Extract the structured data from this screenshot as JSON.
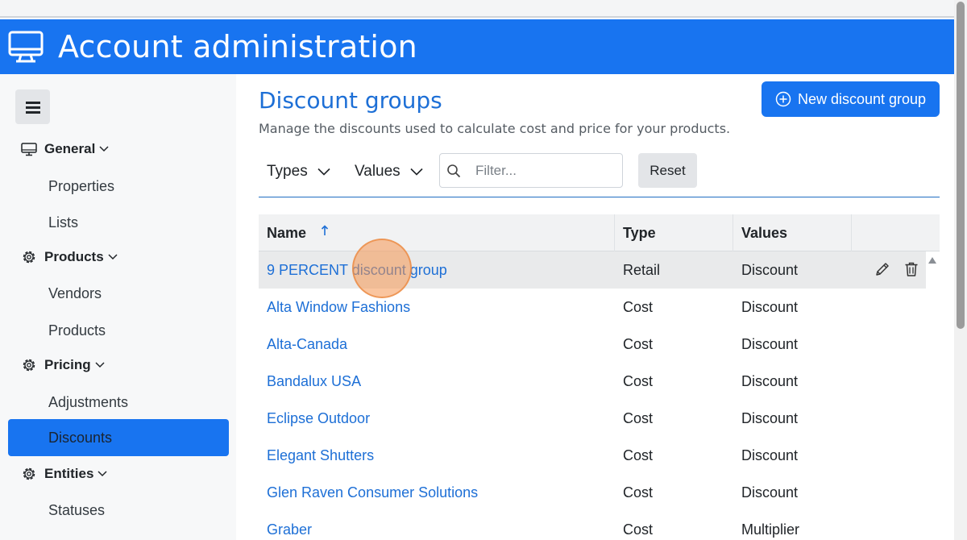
{
  "app": {
    "title": "Account administration",
    "header_color": "#1874f0"
  },
  "sidebar": {
    "menu_toggle_icon": "hamburger-icon",
    "sections": [
      {
        "label": "General",
        "icon": "monitor-icon",
        "items": [
          "Properties",
          "Lists"
        ]
      },
      {
        "label": "Products",
        "icon": "gear-icon",
        "items": [
          "Vendors",
          "Products"
        ]
      },
      {
        "label": "Pricing",
        "icon": "gear-icon",
        "items": [
          "Adjustments",
          "Discounts"
        ]
      },
      {
        "label": "Entities",
        "icon": "gear-icon",
        "items": [
          "Statuses"
        ]
      }
    ],
    "active_item": "Discounts"
  },
  "page": {
    "title": "Discount groups",
    "description": "Manage the discounts used to calculate cost and price for your products.",
    "new_button_label": "New discount group"
  },
  "filters": {
    "types_label": "Types",
    "values_label": "Values",
    "search_placeholder": "Filter...",
    "search_value": "",
    "reset_label": "Reset"
  },
  "table": {
    "columns": [
      "Name",
      "Type",
      "Values"
    ],
    "sort_column": "Name",
    "sort_direction": "ascending",
    "rows": [
      {
        "name": "9 PERCENT discount group",
        "type": "Retail",
        "values": "Discount"
      },
      {
        "name": "Alta Window Fashions",
        "type": "Cost",
        "values": "Discount"
      },
      {
        "name": "Alta-Canada",
        "type": "Cost",
        "values": "Discount"
      },
      {
        "name": "Bandalux USA",
        "type": "Cost",
        "values": "Discount"
      },
      {
        "name": "Eclipse Outdoor",
        "type": "Cost",
        "values": "Discount"
      },
      {
        "name": "Elegant Shutters",
        "type": "Cost",
        "values": "Discount"
      },
      {
        "name": "Glen Raven Consumer Solutions",
        "type": "Cost",
        "values": "Discount"
      },
      {
        "name": "Graber",
        "type": "Cost",
        "values": "Multiplier"
      }
    ],
    "row_action_icons": [
      "pencil-icon",
      "trash-icon"
    ]
  }
}
